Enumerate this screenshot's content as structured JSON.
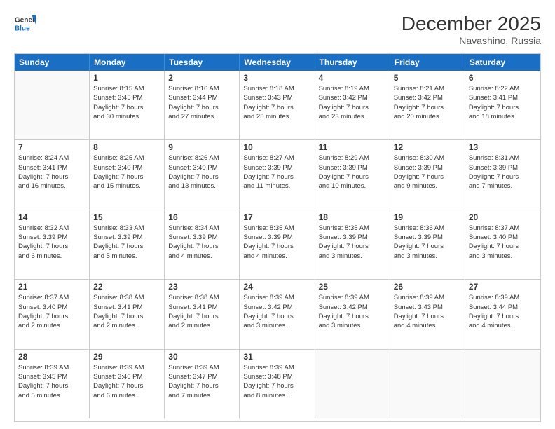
{
  "header": {
    "logo_line1": "General",
    "logo_line2": "Blue",
    "month": "December 2025",
    "location": "Navashino, Russia"
  },
  "weekdays": [
    "Sunday",
    "Monday",
    "Tuesday",
    "Wednesday",
    "Thursday",
    "Friday",
    "Saturday"
  ],
  "weeks": [
    [
      {
        "day": "",
        "info": ""
      },
      {
        "day": "1",
        "info": "Sunrise: 8:15 AM\nSunset: 3:45 PM\nDaylight: 7 hours\nand 30 minutes."
      },
      {
        "day": "2",
        "info": "Sunrise: 8:16 AM\nSunset: 3:44 PM\nDaylight: 7 hours\nand 27 minutes."
      },
      {
        "day": "3",
        "info": "Sunrise: 8:18 AM\nSunset: 3:43 PM\nDaylight: 7 hours\nand 25 minutes."
      },
      {
        "day": "4",
        "info": "Sunrise: 8:19 AM\nSunset: 3:42 PM\nDaylight: 7 hours\nand 23 minutes."
      },
      {
        "day": "5",
        "info": "Sunrise: 8:21 AM\nSunset: 3:42 PM\nDaylight: 7 hours\nand 20 minutes."
      },
      {
        "day": "6",
        "info": "Sunrise: 8:22 AM\nSunset: 3:41 PM\nDaylight: 7 hours\nand 18 minutes."
      }
    ],
    [
      {
        "day": "7",
        "info": "Sunrise: 8:24 AM\nSunset: 3:41 PM\nDaylight: 7 hours\nand 16 minutes."
      },
      {
        "day": "8",
        "info": "Sunrise: 8:25 AM\nSunset: 3:40 PM\nDaylight: 7 hours\nand 15 minutes."
      },
      {
        "day": "9",
        "info": "Sunrise: 8:26 AM\nSunset: 3:40 PM\nDaylight: 7 hours\nand 13 minutes."
      },
      {
        "day": "10",
        "info": "Sunrise: 8:27 AM\nSunset: 3:39 PM\nDaylight: 7 hours\nand 11 minutes."
      },
      {
        "day": "11",
        "info": "Sunrise: 8:29 AM\nSunset: 3:39 PM\nDaylight: 7 hours\nand 10 minutes."
      },
      {
        "day": "12",
        "info": "Sunrise: 8:30 AM\nSunset: 3:39 PM\nDaylight: 7 hours\nand 9 minutes."
      },
      {
        "day": "13",
        "info": "Sunrise: 8:31 AM\nSunset: 3:39 PM\nDaylight: 7 hours\nand 7 minutes."
      }
    ],
    [
      {
        "day": "14",
        "info": "Sunrise: 8:32 AM\nSunset: 3:39 PM\nDaylight: 7 hours\nand 6 minutes."
      },
      {
        "day": "15",
        "info": "Sunrise: 8:33 AM\nSunset: 3:39 PM\nDaylight: 7 hours\nand 5 minutes."
      },
      {
        "day": "16",
        "info": "Sunrise: 8:34 AM\nSunset: 3:39 PM\nDaylight: 7 hours\nand 4 minutes."
      },
      {
        "day": "17",
        "info": "Sunrise: 8:35 AM\nSunset: 3:39 PM\nDaylight: 7 hours\nand 4 minutes."
      },
      {
        "day": "18",
        "info": "Sunrise: 8:35 AM\nSunset: 3:39 PM\nDaylight: 7 hours\nand 3 minutes."
      },
      {
        "day": "19",
        "info": "Sunrise: 8:36 AM\nSunset: 3:39 PM\nDaylight: 7 hours\nand 3 minutes."
      },
      {
        "day": "20",
        "info": "Sunrise: 8:37 AM\nSunset: 3:40 PM\nDaylight: 7 hours\nand 3 minutes."
      }
    ],
    [
      {
        "day": "21",
        "info": "Sunrise: 8:37 AM\nSunset: 3:40 PM\nDaylight: 7 hours\nand 2 minutes."
      },
      {
        "day": "22",
        "info": "Sunrise: 8:38 AM\nSunset: 3:41 PM\nDaylight: 7 hours\nand 2 minutes."
      },
      {
        "day": "23",
        "info": "Sunrise: 8:38 AM\nSunset: 3:41 PM\nDaylight: 7 hours\nand 2 minutes."
      },
      {
        "day": "24",
        "info": "Sunrise: 8:39 AM\nSunset: 3:42 PM\nDaylight: 7 hours\nand 3 minutes."
      },
      {
        "day": "25",
        "info": "Sunrise: 8:39 AM\nSunset: 3:42 PM\nDaylight: 7 hours\nand 3 minutes."
      },
      {
        "day": "26",
        "info": "Sunrise: 8:39 AM\nSunset: 3:43 PM\nDaylight: 7 hours\nand 4 minutes."
      },
      {
        "day": "27",
        "info": "Sunrise: 8:39 AM\nSunset: 3:44 PM\nDaylight: 7 hours\nand 4 minutes."
      }
    ],
    [
      {
        "day": "28",
        "info": "Sunrise: 8:39 AM\nSunset: 3:45 PM\nDaylight: 7 hours\nand 5 minutes."
      },
      {
        "day": "29",
        "info": "Sunrise: 8:39 AM\nSunset: 3:46 PM\nDaylight: 7 hours\nand 6 minutes."
      },
      {
        "day": "30",
        "info": "Sunrise: 8:39 AM\nSunset: 3:47 PM\nDaylight: 7 hours\nand 7 minutes."
      },
      {
        "day": "31",
        "info": "Sunrise: 8:39 AM\nSunset: 3:48 PM\nDaylight: 7 hours\nand 8 minutes."
      },
      {
        "day": "",
        "info": ""
      },
      {
        "day": "",
        "info": ""
      },
      {
        "day": "",
        "info": ""
      }
    ]
  ]
}
